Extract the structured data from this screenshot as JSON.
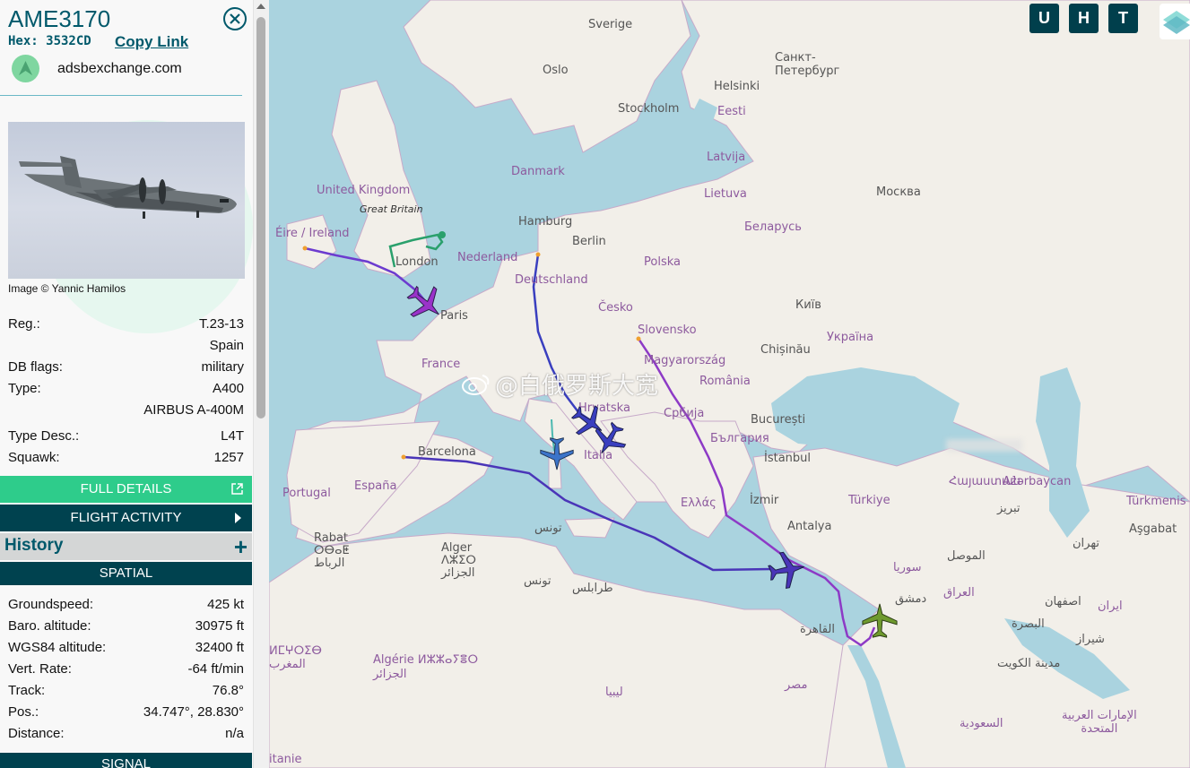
{
  "sidebar": {
    "callsign": "AME3170",
    "hex_label": "Hex: 3532CD",
    "copy_link": "Copy Link",
    "source": "adsbexchange.com",
    "image_credit": "Image © Yannic Hamilos",
    "details": [
      {
        "label": "Reg.:",
        "value": "T.23-13"
      },
      {
        "label": "",
        "value": "Spain"
      },
      {
        "label": "DB flags:",
        "value": "military"
      },
      {
        "label": "Type:",
        "value": "A400"
      },
      {
        "label": "",
        "value": "AIRBUS A-400M"
      },
      {
        "label": "Type Desc.:",
        "value": "L4T"
      },
      {
        "label": "Squawk:",
        "value": "1257"
      }
    ],
    "full_details": "FULL DETAILS",
    "flight_activity": "FLIGHT ACTIVITY",
    "history": "History",
    "history_expand": "+",
    "spatial": "SPATIAL",
    "spatial_rows": [
      {
        "label": "Groundspeed:",
        "value": "425 kt"
      },
      {
        "label": "Baro. altitude:",
        "value": "30975 ft"
      },
      {
        "label": "WGS84 altitude:",
        "value": "32400 ft"
      },
      {
        "label": "Vert. Rate:",
        "value": "-64 ft/min"
      },
      {
        "label": "Track:",
        "value": "76.8°"
      },
      {
        "label": "Pos.:",
        "value": "34.747°, 28.830°"
      },
      {
        "label": "Distance:",
        "value": "n/a"
      }
    ],
    "signal": "SIGNAL"
  },
  "map": {
    "buttons": [
      "U",
      "H",
      "T"
    ],
    "watermark": "@白俄罗斯大宽",
    "labels": {
      "sverige": "Sverige",
      "oslo": "Oslo",
      "spb": "Санкт-\nПетербург",
      "helsinki": "Helsinki",
      "stockholm": "Stockholm",
      "eesti": "Eesti",
      "latvija": "Latvija",
      "danmark": "Danmark",
      "lietuva": "Lietuva",
      "moskva": "Москва",
      "uk": "United Kingdom",
      "gb": "Great Britain",
      "eire": "Éire / Ireland",
      "hamburg": "Hamburg",
      "berlin": "Berlin",
      "nederland": "Nederland",
      "belarus": "Беларусь",
      "london": "London",
      "polska": "Polska",
      "deutschland": "Deutschland",
      "cesko": "Česko",
      "kyiv": "Київ",
      "paris": "Paris",
      "slovensko": "Slovensko",
      "ukraina": "Україна",
      "chisinau": "Chișinău",
      "france": "France",
      "magyar": "Magyarország",
      "romania": "România",
      "hrvatska": "Hrvatska",
      "srbija": "Србија",
      "bucuresti": "București",
      "bulgaria": "България",
      "barcelona": "Barcelona",
      "italia": "Italia",
      "istanbul": "İstanbul",
      "portugal": "Portugal",
      "espana": "España",
      "armenia": "Հայաստան",
      "azerbaycan": "Azərbaycan",
      "turkmen": "Türkmenis",
      "ellada": "Ελλάς",
      "izmir": "İzmir",
      "turkiye": "Türkiye",
      "tabriz": "تبریز",
      "asgabat": "Aşgabat",
      "tunis": "تونس",
      "antalya": "Antalya",
      "rabat": "Rabat\nⵔⴱⴰⵟ\nالرباط",
      "alger": "Alger\nⴷⵣⵉⵔ\nالجزائر",
      "tunis2": "تونس",
      "trablus": "طرابلس",
      "syria": "سوريا",
      "tehran": "تهران",
      "mosul": "الموصل",
      "iraq": "العراق",
      "damascus": "دمشق",
      "isfahan": "اصفهان",
      "iran": "ایران",
      "cairo": "القاهرة",
      "basra": "البصرة",
      "shiraz": "شیراز",
      "maroc": "ⵍⵎⵖⵔⵉⴱ\nالمغرب",
      "algerie": "Algérie ⵍⵣⵣⴰⵢⴻⵔ\nالجزائر",
      "misr": "مصر",
      "libya": "ليبيا",
      "kuwait": "مدينة الكويت",
      "saudi": "السعودية",
      "uae": "الإمارات العربية\nالمتحدة",
      "itanie": "itanie"
    }
  }
}
